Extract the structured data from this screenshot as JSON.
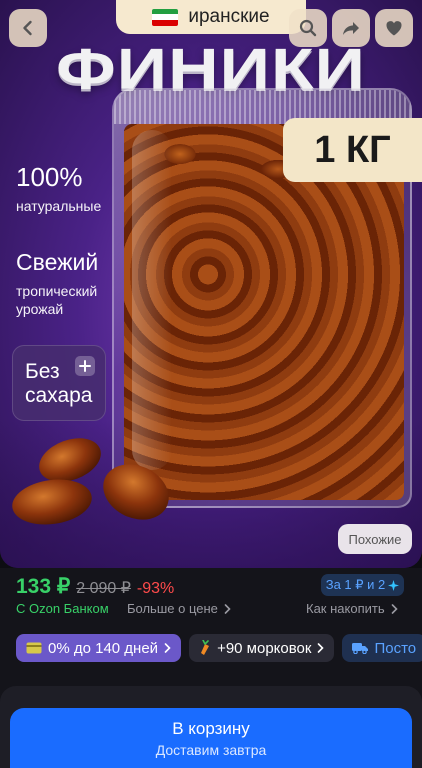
{
  "colors": {
    "price_green": "#38d168",
    "discount_red": "#ff4b4b",
    "cart_blue": "#1a6cff",
    "hero_purple": "#4a2287",
    "chip_purple": "#6b58c9",
    "link_blue": "#5aa2ff"
  },
  "top_bar": {
    "back_icon": "chevron-left-icon",
    "origin_label": "иранские",
    "search_icon": "search-icon",
    "share_icon": "share-arrow-icon",
    "favorite_icon": "heart-icon"
  },
  "hero": {
    "title": "ФИНИКИ",
    "weight_badge": "1 КГ",
    "features": [
      {
        "big": "100%",
        "small": "натуральные"
      },
      {
        "big": "Свежий",
        "small": "тропический урожай"
      }
    ],
    "no_sugar": {
      "line1": "Без",
      "line2": "сахара",
      "icon": "plus-icon"
    },
    "similar_button": "Похожие"
  },
  "price": {
    "current": "133 ₽",
    "old": "2 090 ₽",
    "discount": "-93%",
    "promo": "За 1 ₽ и 2",
    "bank_label": "С Ozon Банком",
    "more_price_link": "Больше о цене",
    "how_to_save_link": "Как накопить"
  },
  "chips": [
    {
      "label": "0% до 140 дней",
      "icon": "card-icon"
    },
    {
      "label": "+90 морковок",
      "icon": "carrot-icon"
    },
    {
      "label": "Посто",
      "icon": "truck-icon"
    }
  ],
  "cart": {
    "button_label": "В корзину",
    "delivery_label": "Доставим завтра"
  }
}
